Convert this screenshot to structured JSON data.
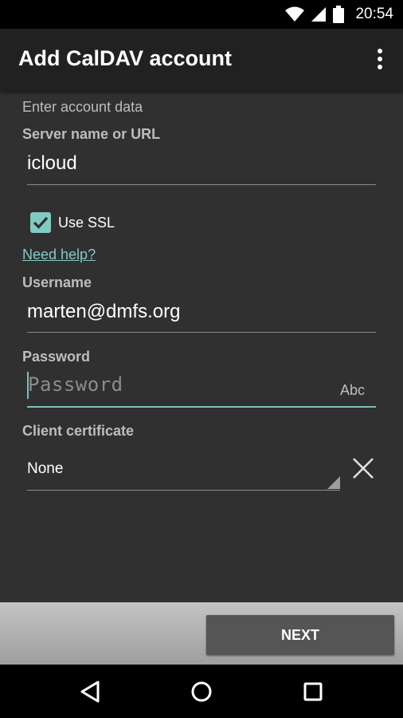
{
  "status_bar": {
    "time": "20:54",
    "icons": [
      "wifi-icon",
      "signal-icon",
      "battery-icon"
    ]
  },
  "app_bar": {
    "title": "Add CalDAV account",
    "menu_icon": "overflow-menu-icon"
  },
  "form": {
    "section_label": "Enter account data",
    "server": {
      "label": "Server name or URL",
      "value": "icloud"
    },
    "ssl": {
      "label": "Use SSL",
      "checked": true
    },
    "help_link": "Need help?",
    "username": {
      "label": "Username",
      "value": "marten@dmfs.org"
    },
    "password": {
      "label": "Password",
      "placeholder": "Password",
      "input_mode": "Abc"
    },
    "client_certificate": {
      "label": "Client certificate",
      "value": "None",
      "clear_icon": "close-icon"
    }
  },
  "actions": {
    "next_label": "NEXT"
  },
  "nav_bar": {
    "icons": [
      "back-icon",
      "home-icon",
      "recents-icon"
    ]
  },
  "colors": {
    "accent": "#80cbc4",
    "background": "#303030",
    "app_bar": "#212121",
    "button": "#555555"
  }
}
